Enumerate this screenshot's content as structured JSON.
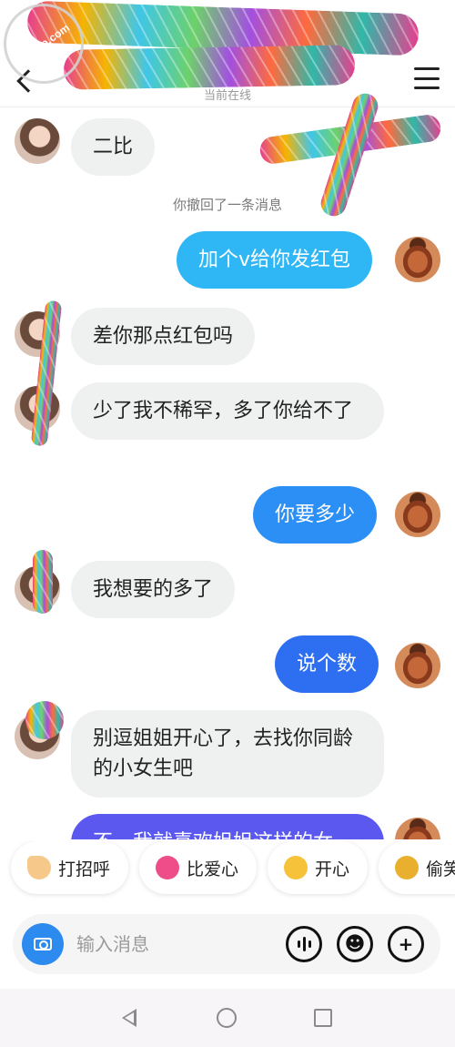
{
  "header": {
    "status_text": "当前在线",
    "watermark": "haijiao.com"
  },
  "chat": {
    "messages": [
      {
        "side": "in",
        "text": "二比"
      },
      {
        "side": "system",
        "text": "你撤回了一条消息"
      },
      {
        "side": "out",
        "text": "加个v给你发红包"
      },
      {
        "side": "in",
        "text": "差你那点红包吗"
      },
      {
        "side": "in",
        "text": "少了我不稀罕，多了你给不了"
      },
      {
        "side": "out",
        "text": "你要多少"
      },
      {
        "side": "in",
        "text": "我想要的多了"
      },
      {
        "side": "out",
        "text": "说个数"
      },
      {
        "side": "in",
        "text": "别逗姐姐开心了，去找你同龄的小女生吧"
      },
      {
        "side": "out",
        "text": "不，我就喜欢姐姐这样的女"
      }
    ]
  },
  "quick_replies": [
    {
      "label": "打招呼",
      "icon": "wave-emoji-icon"
    },
    {
      "label": "比爱心",
      "icon": "heart-emoji-icon"
    },
    {
      "label": "开心",
      "icon": "happy-emoji-icon"
    },
    {
      "label": "偷笑",
      "icon": "smirk-emoji-icon"
    }
  ],
  "input": {
    "placeholder": "输入消息",
    "plus_label": "+"
  },
  "colors": {
    "bubble_in": "#eff1f1",
    "bubble_out_light": "#2fb6f5",
    "bubble_out_deep": "#2e6ff2",
    "camera": "#2d8bf0"
  }
}
